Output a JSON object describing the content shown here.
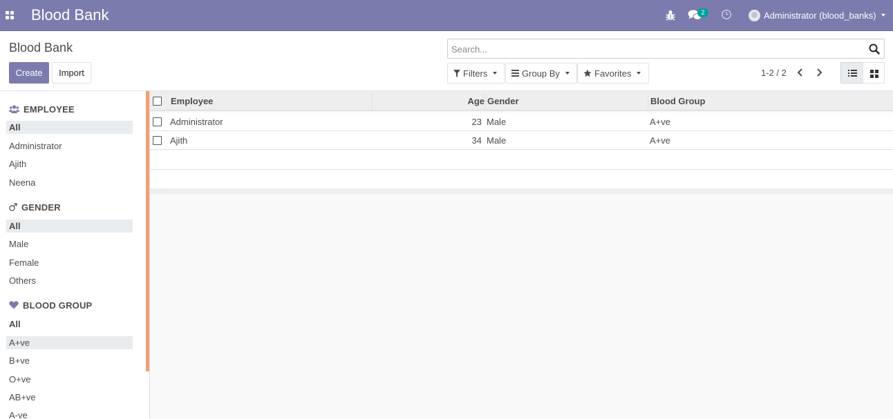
{
  "navbar": {
    "app_title": "Blood Bank",
    "chat_count": "2",
    "user_label": "Administrator (blood_banks)",
    "bg_color": "#7c7bad"
  },
  "control_panel": {
    "breadcrumb": "Blood Bank",
    "create_label": "Create",
    "import_label": "Import",
    "search_placeholder": "Search...",
    "filters_label": "Filters",
    "groupby_label": "Group By",
    "favorites_label": "Favorites",
    "pager": "1-2 / 2",
    "active_view": "list"
  },
  "search_panel": {
    "sections": [
      {
        "title": "EMPLOYEE",
        "icon": "users-icon",
        "items": [
          "All",
          "Administrator",
          "Ajith",
          "Neena"
        ],
        "selected": "All"
      },
      {
        "title": "GENDER",
        "icon": "male-icon",
        "items": [
          "All",
          "Male",
          "Female",
          "Others"
        ],
        "selected": "All"
      },
      {
        "title": "BLOOD GROUP",
        "icon": "heart-icon",
        "items": [
          "All",
          "A+ve",
          "B+ve",
          "O+ve",
          "AB+ve",
          "A-ve"
        ],
        "selected": "A+ve"
      }
    ],
    "accent_color": "#f39e75"
  },
  "list": {
    "columns": [
      "Employee",
      "Age",
      "Gender",
      "Blood Group"
    ],
    "rows": [
      {
        "employee": "Administrator",
        "age": "23",
        "gender": "Male",
        "blood_group": "A+ve"
      },
      {
        "employee": "Ajith",
        "age": "34",
        "gender": "Male",
        "blood_group": "A+ve"
      }
    ]
  }
}
